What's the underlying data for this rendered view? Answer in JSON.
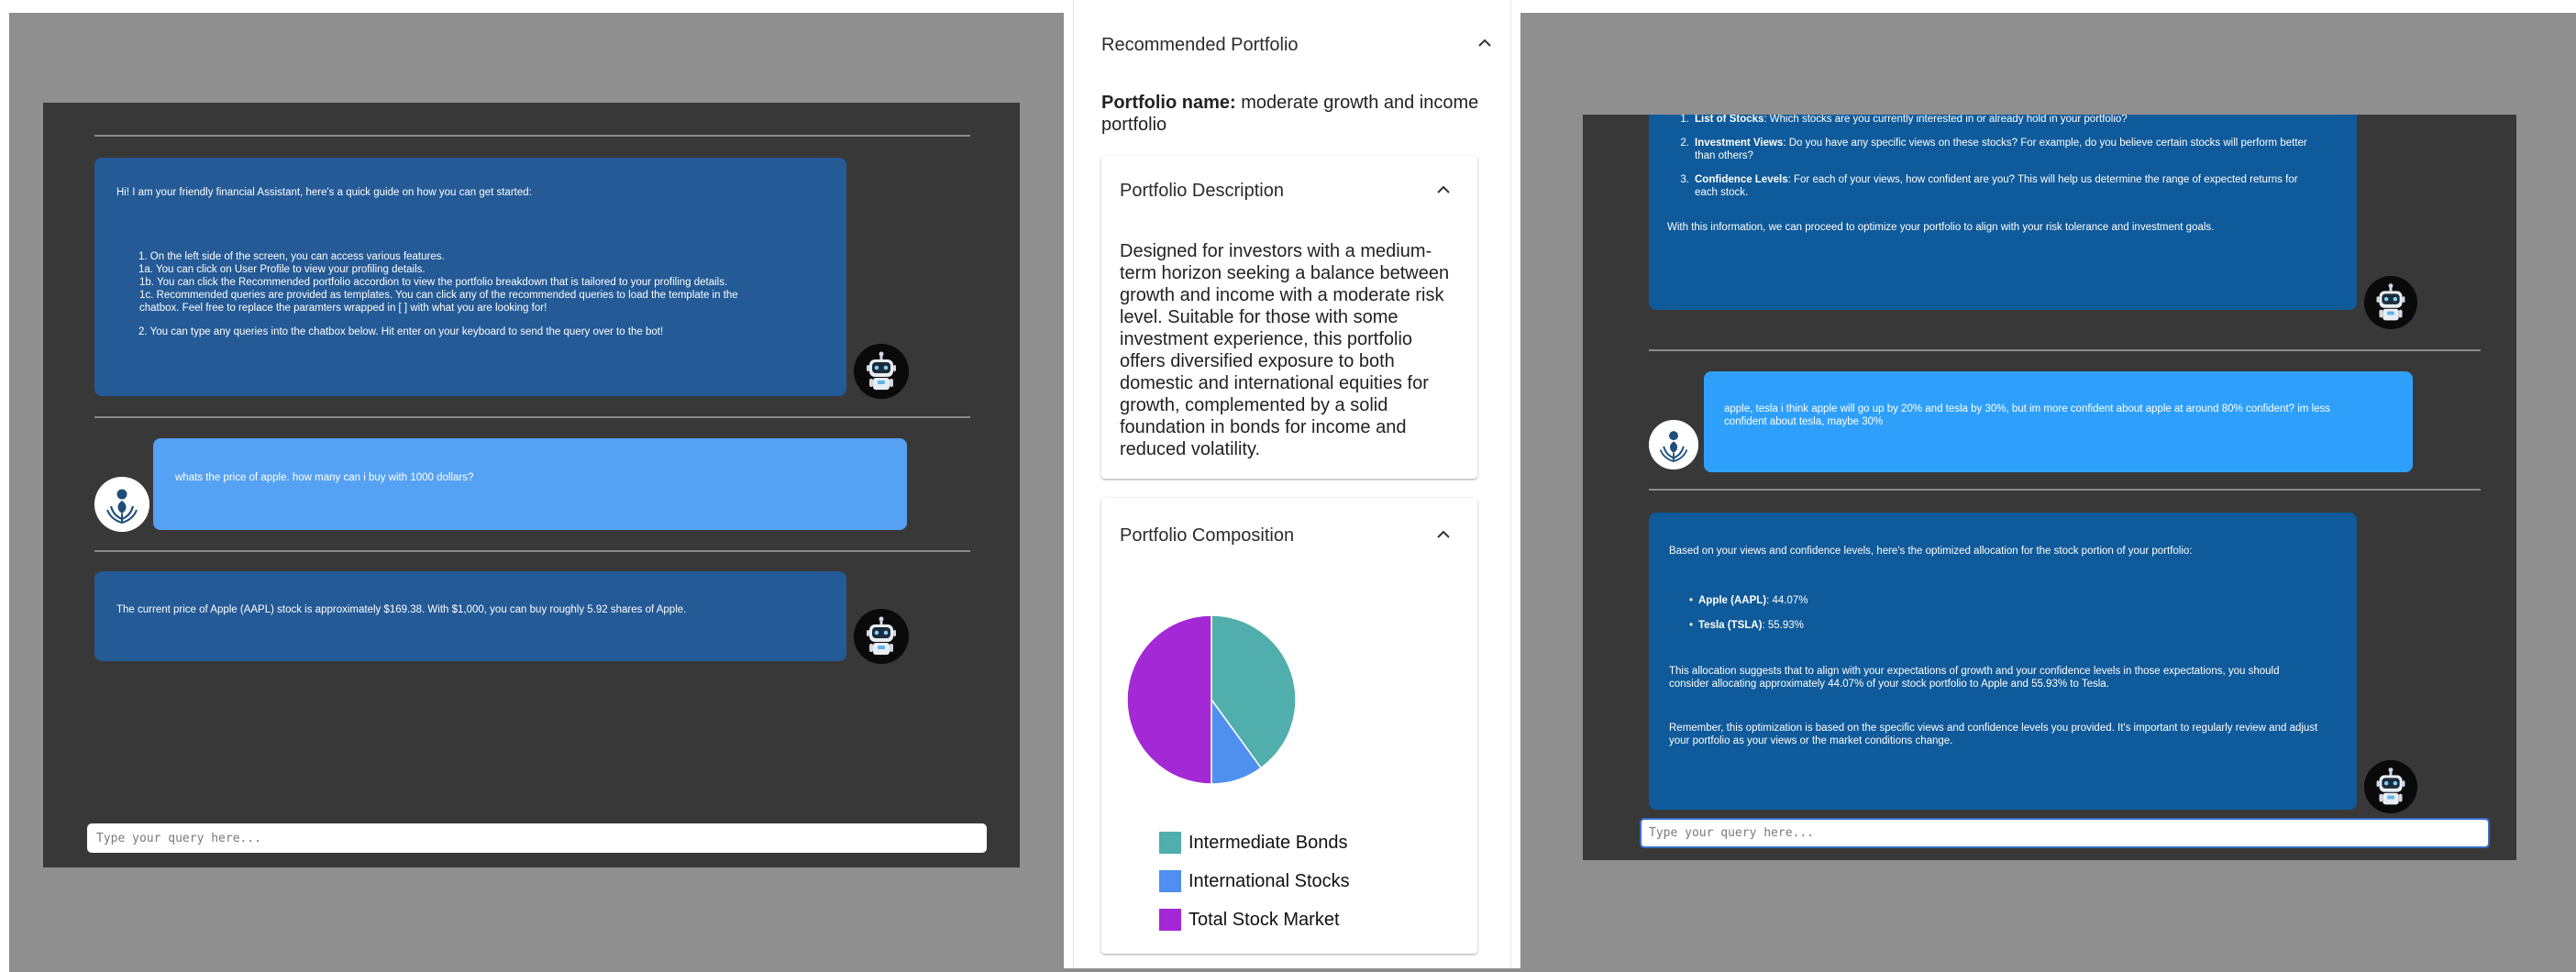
{
  "left_chat": {
    "welcome": {
      "intro": "Hi! I am your friendly financial Assistant, here's a quick guide on how you can get started:",
      "item1_num": "1.",
      "item1_text": "On the left side of the screen, you can access various features.",
      "item1a": "1a. You can click on User Profile to view your profiling details.",
      "item1b": "1b. You can click the Recommended portfolio accordion to view the portfolio breakdown that is tailored to your profiling details.",
      "item1c_line1": "1c. Recommended queries are provided as templates. You can click any of the recommended queries to load the template in the",
      "item1c_line2": "chatbox. Feel free to replace the paramters wrapped in [ ] with what you are looking for!",
      "item2_num": "2.",
      "item2_text": "You can type any queries into the chatbox below. Hit enter on your keyboard to send the query over to the bot!"
    },
    "user_message": "whats the price of apple. how many can i buy with 1000 dollars?",
    "bot_reply": "The current price of Apple (AAPL) stock is approximately $169.38. With $1,000, you can buy roughly 5.92 shares of Apple.",
    "input_placeholder": "Type your query here..."
  },
  "portfolio": {
    "header": "Recommended Portfolio",
    "name_label": "Portfolio name:",
    "name_value": "moderate growth and income",
    "name_value_line2": "portfolio",
    "description_header": "Portfolio Description",
    "description_lines": [
      "Designed for investors with a medium-",
      "term horizon seeking a balance between",
      "growth and income with a moderate risk",
      "level. Suitable for those with some",
      "investment experience, this portfolio",
      "offers diversified exposure to both",
      "domestic and international equities for",
      "growth, complemented by a solid",
      "foundation in bonds for income and",
      "reduced volatility."
    ],
    "composition_header": "Portfolio Composition"
  },
  "chart_data": {
    "type": "pie",
    "categories": [
      "Intermediate Bonds",
      "International Stocks",
      "Total Stock Market"
    ],
    "values": [
      40,
      10,
      50
    ],
    "colors": [
      "#50aeac",
      "#4f8ff0",
      "#a428d6"
    ],
    "legend": "bottom"
  },
  "right_chat": {
    "list_items": [
      {
        "num": "1.",
        "bold": "List of Stocks",
        "text": ": Which stocks are you currently interested in or already hold in your portfolio?"
      },
      {
        "num": "2.",
        "bold": "Investment Views",
        "text": ": Do you have any specific views on these stocks? For example, do you believe certain stocks will perform better",
        "text2": "than others?"
      },
      {
        "num": "3.",
        "bold": "Confidence Levels",
        "text": ": For each of your views, how confident are you? This will help us determine the range of expected returns for",
        "text2": "each stock."
      }
    ],
    "proceed_text": "With this information, we can proceed to optimize your portfolio to align with your risk tolerance and investment goals.",
    "user_message_line1": "apple, tesla i think apple will go up by 20% and tesla by 30%, but im more confident about apple at around 80% confident? im less",
    "user_message_line2": "confident about tesla, maybe 30%",
    "alloc_intro": "Based on your views and confidence levels, here's the optimized allocation for the stock portion of your portfolio:",
    "alloc_items": [
      {
        "bullet": "•",
        "bold": "Apple (AAPL)",
        "text": ": 44.07%"
      },
      {
        "bullet": "•",
        "bold": "Tesla (TSLA)",
        "text": ": 55.93%"
      }
    ],
    "alloc_note_line1": "This allocation suggests that to align with your expectations of growth and your confidence levels in those expectations, you should",
    "alloc_note_line2": "consider allocating approximately 44.07% of your stock portfolio to Apple and 55.93% to Tesla.",
    "remember_line1": "Remember, this optimization is based on the specific views and confidence levels you provided. It's important to regularly review and adjust",
    "remember_line2": "your portfolio as your views or the market conditions change.",
    "input_placeholder": "Type your query here..."
  },
  "icons": {
    "bot_avatar": "robot-icon",
    "user_avatar": "user-logo-icon",
    "accordion_toggle": "chevron-up-icon"
  }
}
